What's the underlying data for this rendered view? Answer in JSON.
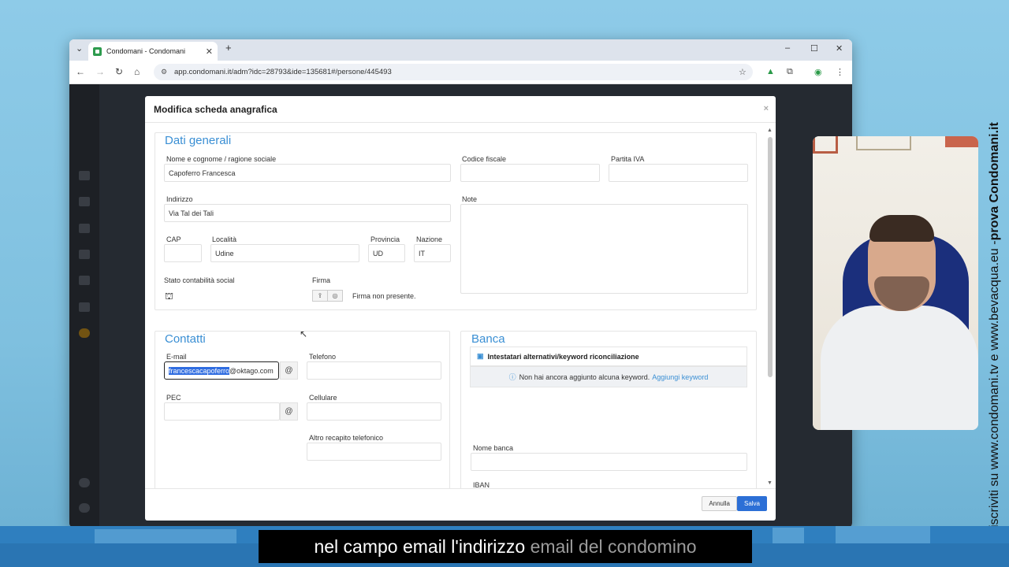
{
  "browser": {
    "tab_title": "Condomani - Condomani",
    "url": "app.condomani.it/adm?idc=28793&ide=135681#/persone/445493"
  },
  "modal": {
    "title": "Modifica scheda anagrafica",
    "close": "×",
    "dati_generali": {
      "title": "Dati generali",
      "nome_label": "Nome e cognome / ragione sociale",
      "nome_value": "Capoferro Francesca",
      "codice_fiscale_label": "Codice fiscale",
      "codice_fiscale_value": "",
      "partita_iva_label": "Partita IVA",
      "partita_iva_value": "",
      "indirizzo_label": "Indirizzo",
      "indirizzo_value": "Via Tal dei Tali",
      "note_label": "Note",
      "note_value": "",
      "cap_label": "CAP",
      "cap_value": "",
      "localita_label": "Località",
      "localita_value": "Udine",
      "provincia_label": "Provincia",
      "provincia_value": "UD",
      "nazione_label": "Nazione",
      "nazione_value": "IT",
      "stato_label": "Stato contabilità social",
      "firma_label": "Firma",
      "firma_status": "Firma non presente."
    },
    "contatti": {
      "title": "Contatti",
      "email_label": "E-mail",
      "email_selected": "francescacapoferro",
      "email_rest": "@oktago.com",
      "telefono_label": "Telefono",
      "telefono_value": "",
      "pec_label": "PEC",
      "pec_value": "",
      "cellulare_label": "Cellulare",
      "cellulare_value": "",
      "altro_label": "Altro recapito telefonico",
      "altro_value": "",
      "at_symbol": "@"
    },
    "banca": {
      "title": "Banca",
      "keyword_header": "Intestatari alternativi/keyword riconciliazione",
      "keyword_info": "Non hai ancora aggiunto alcuna keyword.",
      "keyword_link": "Aggiungi keyword",
      "nome_banca_label": "Nome banca",
      "nome_banca_value": "",
      "iban_label": "IBAN"
    },
    "footer": {
      "annulla": "Annulla",
      "salva": "Salva"
    }
  },
  "overlay": {
    "vertical_text_prefix": "iscriviti su www.condomani.tv e www.bevacqua.eu - ",
    "vertical_text_bold": "prova Condomani.it",
    "caption_main": "nel campo email l'indirizzo ",
    "caption_dim": "email del condomino"
  },
  "colors": {
    "accent": "#3a8fd4",
    "save_button": "#2c6fd6",
    "background": "#7fc0df"
  }
}
